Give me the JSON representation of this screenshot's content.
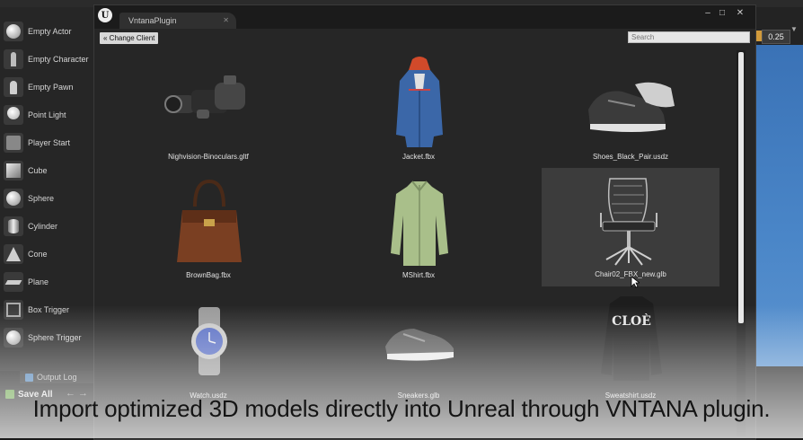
{
  "place_actors": {
    "items": [
      {
        "label": "Empty Actor",
        "icon": "sphere-icon"
      },
      {
        "label": "Empty Character",
        "icon": "character-icon"
      },
      {
        "label": "Empty Pawn",
        "icon": "pawn-icon"
      },
      {
        "label": "Point Light",
        "icon": "point-light-icon"
      },
      {
        "label": "Player Start",
        "icon": "player-start-icon"
      },
      {
        "label": "Cube",
        "icon": "cube-icon"
      },
      {
        "label": "Sphere",
        "icon": "sphere-icon"
      },
      {
        "label": "Cylinder",
        "icon": "cylinder-icon"
      },
      {
        "label": "Cone",
        "icon": "cone-icon"
      },
      {
        "label": "Plane",
        "icon": "plane-icon"
      },
      {
        "label": "Box Trigger",
        "icon": "box-trigger-icon"
      },
      {
        "label": "Sphere Trigger",
        "icon": "sphere-trigger-icon"
      }
    ]
  },
  "output_log": {
    "label": "Output Log"
  },
  "toolbar": {
    "save_all": "Save All"
  },
  "viewport": {
    "value": "0.25"
  },
  "plugin": {
    "tab_title": "VntanaPlugin",
    "change_client": "« Change Client",
    "search_placeholder": "Search",
    "assets": [
      {
        "name": "Nighvision-Binoculars.gltf",
        "icon": "binoculars-thumbnail"
      },
      {
        "name": "Jacket.fbx",
        "icon": "jacket-thumbnail"
      },
      {
        "name": "Shoes_Black_Pair.usdz",
        "icon": "shoes-thumbnail"
      },
      {
        "name": "BrownBag.fbx",
        "icon": "bag-thumbnail"
      },
      {
        "name": "MShirt.fbx",
        "icon": "shirt-thumbnail"
      },
      {
        "name": "Chair02_FBX_new.glb",
        "icon": "chair-thumbnail",
        "selected": true
      },
      {
        "name": "Watch.usdz",
        "icon": "watch-thumbnail"
      },
      {
        "name": "Sneakers.glb",
        "icon": "sneaker-thumbnail"
      },
      {
        "name": "Sweatshirt.usdz",
        "icon": "sweatshirt-thumbnail",
        "print_text": "CLOÈ"
      }
    ]
  },
  "caption": "Import optimized 3D models directly into Unreal through VNTANA plugin.",
  "colors": {
    "viewport_sky": "#4a86c8",
    "selected_tile": "#3c3c3c",
    "panel_bg": "#262626"
  }
}
